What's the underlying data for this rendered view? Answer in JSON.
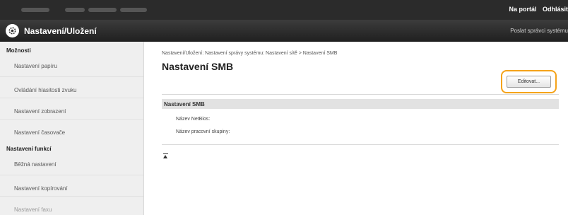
{
  "topbar": {
    "links": [
      "Na portál",
      "Odhlásit"
    ]
  },
  "modebar": {
    "title": "Nastavení/Uložení",
    "right_link": "Poslat správci systému"
  },
  "sidebar": {
    "sections": [
      {
        "title": "Možnosti",
        "items": [
          "Nastavení papíru",
          "Ovládání hlasitosti zvuku",
          "Nastavení zobrazení",
          "Nastavení časovače"
        ]
      },
      {
        "title": "Nastavení funkcí",
        "items": [
          "Běžná nastavení",
          "Nastavení kopírování",
          "Nastavení faxu"
        ]
      }
    ]
  },
  "main": {
    "breadcrumb": "Nastavení/Uložení: Nastavení správy systému: Nastavení sítě > Nastavení SMB",
    "title": "Nastavení SMB",
    "edit_label": "Editovat...",
    "section_title": "Nastavení SMB",
    "fields": [
      "Název NetBios:",
      "Název pracovní skupiny:"
    ]
  },
  "colors": {
    "highlight": "#f5a31a",
    "topbar": "#2b2b2b"
  },
  "icons": {
    "mode_icon": "settings-gear-icon",
    "back_to_top": "back-to-top-icon"
  }
}
